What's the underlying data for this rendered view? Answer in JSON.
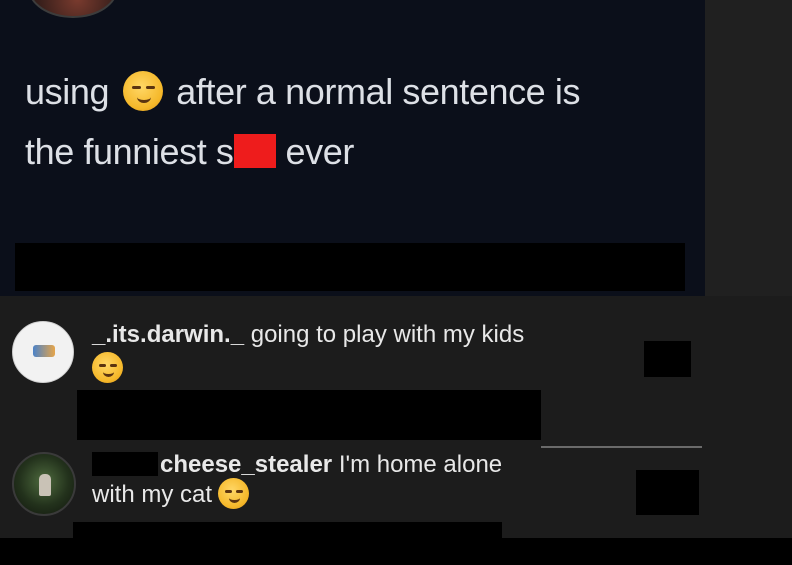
{
  "post": {
    "text_line1_before": "using",
    "text_line1_after": "after a normal sentence is",
    "text_line2_before": "the funniest s",
    "text_line2_after": "ever",
    "emoji": "smirking-face-emoji"
  },
  "comments": [
    {
      "username": "_.its.darwin._",
      "text": "going to play with my kids",
      "emoji": "smirking-face-emoji"
    },
    {
      "username": "cheese_stealer",
      "text_line1": "I'm home alone",
      "text_line2": "with my cat",
      "emoji": "smirking-face-emoji"
    }
  ],
  "colors": {
    "tweet_background": "#0b0f1a",
    "page_background": "#1c1c1c",
    "censor_red": "#ee1c1c",
    "censor_black": "#000000",
    "text": "#e8e8e8"
  }
}
